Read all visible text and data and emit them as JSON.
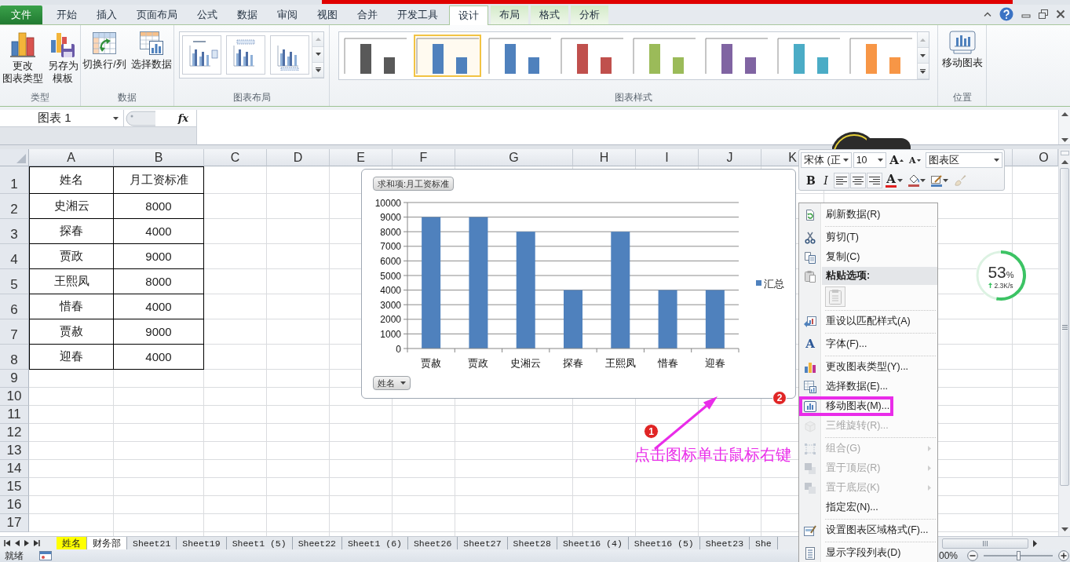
{
  "ribbon": {
    "tabs": [
      {
        "label": "文件",
        "kind": "file",
        "selected": false
      },
      {
        "label": "开始",
        "kind": "normal",
        "selected": false
      },
      {
        "label": "插入",
        "kind": "normal",
        "selected": false
      },
      {
        "label": "页面布局",
        "kind": "normal",
        "selected": false
      },
      {
        "label": "公式",
        "kind": "normal",
        "selected": false
      },
      {
        "label": "数据",
        "kind": "normal",
        "selected": false
      },
      {
        "label": "审阅",
        "kind": "normal",
        "selected": false
      },
      {
        "label": "视图",
        "kind": "normal",
        "selected": false
      },
      {
        "label": "合并",
        "kind": "normal",
        "selected": false
      },
      {
        "label": "开发工具",
        "kind": "normal",
        "selected": false
      },
      {
        "label": "设计",
        "kind": "contextual",
        "selected": true
      },
      {
        "label": "布局",
        "kind": "contextual",
        "selected": false
      },
      {
        "label": "格式",
        "kind": "contextual",
        "selected": false
      },
      {
        "label": "分析",
        "kind": "contextual",
        "selected": false
      }
    ],
    "groups": [
      {
        "kind": "buttons",
        "label": "类型",
        "buttons": [
          {
            "lines": [
              "更改",
              "图表类型"
            ]
          },
          {
            "lines": [
              "另存为",
              "模板"
            ]
          }
        ]
      },
      {
        "kind": "buttons",
        "label": "数据",
        "buttons": [
          {
            "lines": [
              "切换行/列"
            ]
          },
          {
            "lines": [
              "选择数据"
            ]
          }
        ]
      },
      {
        "kind": "layouts",
        "label": "图表布局",
        "items": [
          {
            "kind": "legend-right"
          },
          {
            "kind": "title-top"
          },
          {
            "kind": "legend-bottom"
          }
        ]
      },
      {
        "kind": "styles",
        "label": "图表样式",
        "items": [
          {
            "color": "#595959",
            "selected": false
          },
          {
            "color": "#4f81bd",
            "selected": true
          },
          {
            "color": "#4f81bd",
            "selected": false
          },
          {
            "color": "#c0504d",
            "selected": false
          },
          {
            "color": "#9bbb59",
            "selected": false
          },
          {
            "color": "#8064a2",
            "selected": false
          },
          {
            "color": "#4bacc6",
            "selected": false
          },
          {
            "color": "#f79646",
            "selected": false
          }
        ]
      },
      {
        "kind": "buttons",
        "label": "位置",
        "buttons": [
          {
            "lines": [
              "移动图表"
            ]
          }
        ]
      }
    ]
  },
  "formula_bar": {
    "name_box": "图表 1",
    "function_button": "fx"
  },
  "sheet": {
    "columns": [
      "A",
      "B",
      "C",
      "D",
      "E",
      "F",
      "G",
      "H",
      "I",
      "J",
      "K",
      "O"
    ],
    "rows": [
      {
        "number": "1",
        "cells": [
          "姓名",
          "月工资标准"
        ]
      },
      {
        "number": "2",
        "cells": [
          "史湘云",
          "8000"
        ]
      },
      {
        "number": "3",
        "cells": [
          "探春",
          "4000"
        ]
      },
      {
        "number": "4",
        "cells": [
          "贾政",
          "9000"
        ]
      },
      {
        "number": "5",
        "cells": [
          "王熙凤",
          "8000"
        ]
      },
      {
        "number": "6",
        "cells": [
          "惜春",
          "4000"
        ]
      },
      {
        "number": "7",
        "cells": [
          "贾赦",
          "9000"
        ]
      },
      {
        "number": "8",
        "cells": [
          "迎春",
          "4000"
        ]
      },
      {
        "number": "9"
      },
      {
        "number": "10"
      },
      {
        "number": "11"
      },
      {
        "number": "12"
      },
      {
        "number": "13"
      },
      {
        "number": "14"
      },
      {
        "number": "15"
      },
      {
        "number": "16"
      },
      {
        "number": "17"
      }
    ]
  },
  "chart": {
    "field_buttons": [
      {
        "kind": "value",
        "label": "求和项:月工资标准"
      },
      {
        "kind": "axis",
        "label": "姓名"
      }
    ],
    "chart_data": {
      "type": "bar",
      "categories": [
        "贾赦",
        "贾政",
        "史湘云",
        "探春",
        "王熙凤",
        "惜春",
        "迎春"
      ],
      "series": [
        {
          "name": "汇总",
          "color": "#4f81bd",
          "values": [
            9000,
            9000,
            8000,
            4000,
            8000,
            4000,
            4000
          ]
        }
      ],
      "ylim": [
        0,
        10000
      ],
      "yticks": [
        0,
        1000,
        2000,
        3000,
        4000,
        5000,
        6000,
        7000,
        8000,
        9000,
        10000
      ],
      "grid": true
    }
  },
  "mini_toolbar": {
    "font": "宋体 (正",
    "size": "10",
    "element": "图表区",
    "size_tools": [
      {
        "kind": "grow-font",
        "label": "A",
        "disabled": false
      },
      {
        "kind": "shrink-font",
        "label": "A",
        "disabled": false
      }
    ],
    "format_tools": [
      {
        "kind": "bold",
        "label": "B",
        "disabled": false
      },
      {
        "kind": "italic",
        "label": "I",
        "disabled": false
      },
      {
        "kind": "align-left",
        "disabled": false
      },
      {
        "kind": "align-center",
        "disabled": false
      },
      {
        "kind": "align-right",
        "disabled": false
      },
      {
        "kind": "font-color",
        "label": "A",
        "color": "#e01e1e",
        "disabled": false
      },
      {
        "kind": "fill-color",
        "color": "#c0504d",
        "disabled": false
      },
      {
        "kind": "outline-color",
        "color": "#4f81bd",
        "disabled": false
      },
      {
        "kind": "format-painter",
        "disabled": true
      }
    ]
  },
  "context_menu": {
    "groups": [
      [
        {
          "kind": "command",
          "label": "刷新数据(R)",
          "disabled": false,
          "submenu": false,
          "framed": false
        }
      ],
      [
        {
          "kind": "command",
          "label": "剪切(T)",
          "disabled": false,
          "submenu": false,
          "framed": false
        },
        {
          "kind": "command",
          "label": "复制(C)",
          "disabled": false,
          "submenu": false,
          "framed": false
        },
        {
          "kind": "heading",
          "label": "粘贴选项:",
          "disabled": false,
          "submenu": false,
          "framed": false
        },
        {
          "kind": "paste-button",
          "disabled": true,
          "submenu": false,
          "framed": false
        }
      ],
      [
        {
          "kind": "command",
          "label": "重设以匹配样式(A)",
          "disabled": false,
          "submenu": false,
          "framed": false
        }
      ],
      [
        {
          "kind": "command",
          "label": "字体(F)...",
          "glyph": "A",
          "disabled": false,
          "submenu": false,
          "framed": false
        }
      ],
      [
        {
          "kind": "command",
          "label": "更改图表类型(Y)...",
          "disabled": false,
          "submenu": false,
          "framed": false
        },
        {
          "kind": "command",
          "label": "选择数据(E)...",
          "disabled": false,
          "submenu": false,
          "framed": false
        },
        {
          "kind": "command",
          "label": "移动图表(M)...",
          "disabled": false,
          "submenu": false,
          "framed": true
        },
        {
          "kind": "command",
          "label": "三维旋转(R)...",
          "disabled": true,
          "submenu": false,
          "framed": false
        }
      ],
      [
        {
          "kind": "command",
          "label": "组合(G)",
          "disabled": true,
          "submenu": true,
          "framed": false
        },
        {
          "kind": "command",
          "label": "置于顶层(R)",
          "disabled": true,
          "submenu": true,
          "framed": false
        },
        {
          "kind": "command",
          "label": "置于底层(K)",
          "disabled": true,
          "submenu": true,
          "framed": false
        },
        {
          "kind": "command",
          "label": "指定宏(N)...",
          "disabled": false,
          "submenu": false,
          "framed": false
        }
      ],
      [
        {
          "kind": "command",
          "label": "设置图表区域格式(F)...",
          "disabled": false,
          "submenu": false,
          "framed": false
        }
      ],
      [
        {
          "kind": "command",
          "label": "显示字段列表(D)",
          "disabled": false,
          "submenu": false,
          "framed": false
        }
      ]
    ]
  },
  "speed_widget": {
    "percent": "53",
    "unit": "%",
    "rate": "2.3K/s",
    "level": 0.53
  },
  "annotations": {
    "steps": [
      {
        "label": "1"
      },
      {
        "label": "2"
      }
    ],
    "caption": "点击图标单击鼠标右键"
  },
  "sheet_tabs": [
    {
      "label": "姓名",
      "selected": false,
      "color": "#ffff00"
    },
    {
      "label": "财务部",
      "selected": true
    },
    {
      "label": "Sheet21",
      "selected": false
    },
    {
      "label": "Sheet19",
      "selected": false
    },
    {
      "label": "Sheet1 (5)",
      "selected": false
    },
    {
      "label": "Sheet22",
      "selected": false
    },
    {
      "label": "Sheet1 (6)",
      "selected": false
    },
    {
      "label": "Sheet26",
      "selected": false
    },
    {
      "label": "Sheet27",
      "selected": false
    },
    {
      "label": "Sheet28",
      "selected": false
    },
    {
      "label": "Sheet16 (4)",
      "selected": false
    },
    {
      "label": "Sheet16 (5)",
      "selected": false
    },
    {
      "label": "Sheet23",
      "selected": false
    },
    {
      "label": "She",
      "selected": false
    }
  ],
  "status_bar": {
    "text": "就绪",
    "zoom": "00%",
    "zoom_slider": {
      "level": 0.5
    }
  }
}
